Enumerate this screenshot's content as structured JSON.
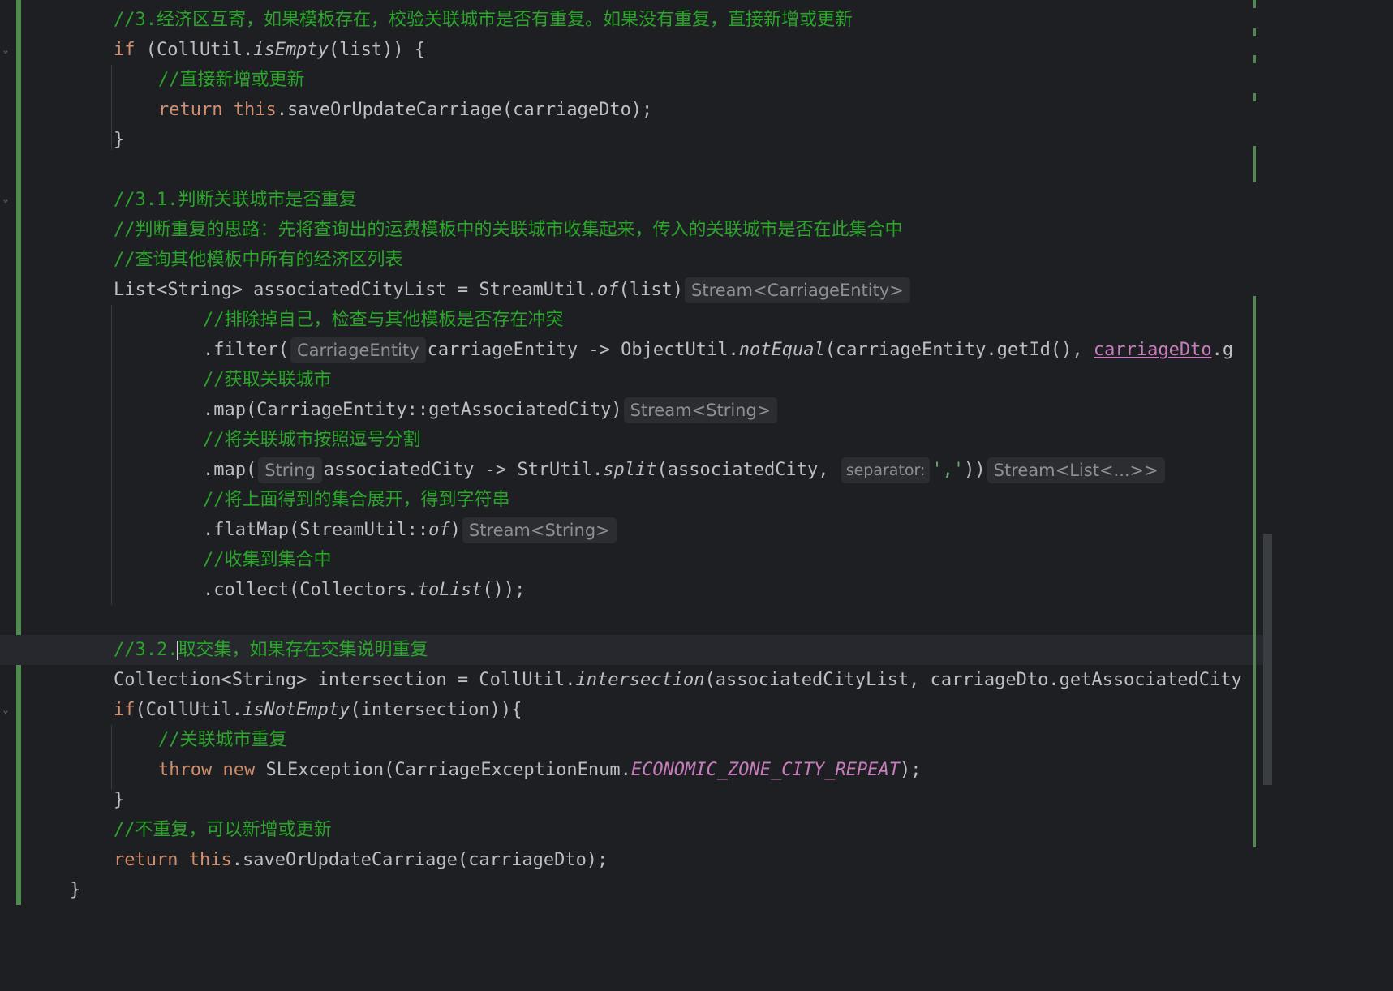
{
  "editor": {
    "lines": [
      {
        "tokens": [
          {
            "t": "//3.经济区互寄，如果模板存在，校验关联城市是否有重复。如果没有重复，直接新增或更新",
            "c": "cm"
          }
        ]
      },
      {
        "tokens": [
          {
            "t": "if",
            "c": "kw"
          },
          {
            "t": " (CollUtil."
          },
          {
            "t": "isEmpty",
            "c": "it"
          },
          {
            "t": "(list)) {"
          }
        ]
      },
      {
        "tokens": [
          {
            "t": "//直接新增或更新",
            "c": "cm"
          }
        ]
      },
      {
        "tokens": [
          {
            "t": "return",
            "c": "kw"
          },
          {
            "t": " "
          },
          {
            "t": "this",
            "c": "kw"
          },
          {
            "t": ".saveOrUpdateCarriage(carriageDto);"
          }
        ]
      },
      {
        "tokens": [
          {
            "t": "}"
          }
        ]
      },
      {
        "tokens": []
      },
      {
        "tokens": [
          {
            "t": "//3.1.判断关联城市是否重复",
            "c": "cm"
          }
        ]
      },
      {
        "tokens": [
          {
            "t": "//判断重复的思路：先将查询出的运费模板中的关联城市收集起来，传入的关联城市是否在此集合中",
            "c": "cm"
          }
        ]
      },
      {
        "tokens": [
          {
            "t": "//查询其他模板中所有的经济区列表",
            "c": "cm"
          }
        ]
      },
      {
        "tokens": [
          {
            "t": "List<String> associatedCityList = StreamUtil."
          },
          {
            "t": "of",
            "c": "it"
          },
          {
            "t": "(list)"
          },
          {
            "t": "Stream<CarriageEntity>",
            "c": "hint"
          }
        ]
      },
      {
        "tokens": [
          {
            "t": "//排除掉自己，检查与其他模板是否存在冲突",
            "c": "cm"
          }
        ]
      },
      {
        "tokens": [
          {
            "t": ".filter("
          },
          {
            "t": "CarriageEntity",
            "c": "hint"
          },
          {
            "t": "carriageEntity -> ObjectUtil."
          },
          {
            "t": "notEqual",
            "c": "it"
          },
          {
            "t": "(carriageEntity.getId(), "
          },
          {
            "t": "carriageDto",
            "c": "err"
          },
          {
            "t": ".g"
          }
        ]
      },
      {
        "tokens": [
          {
            "t": "//获取关联城市",
            "c": "cm"
          }
        ]
      },
      {
        "tokens": [
          {
            "t": ".map(CarriageEntity::getAssociatedCity)"
          },
          {
            "t": "Stream<String>",
            "c": "hint"
          }
        ]
      },
      {
        "tokens": [
          {
            "t": "//将关联城市按照逗号分割",
            "c": "cm"
          }
        ]
      },
      {
        "tokens": [
          {
            "t": ".map("
          },
          {
            "t": "String",
            "c": "hint"
          },
          {
            "t": "associatedCity -> StrUtil."
          },
          {
            "t": "split",
            "c": "it"
          },
          {
            "t": "(associatedCity, "
          },
          {
            "t": "separator:",
            "c": "hint param"
          },
          {
            "t": "','",
            "c": "st"
          },
          {
            "t": "))"
          },
          {
            "t": "Stream<List<...>>",
            "c": "hint"
          }
        ]
      },
      {
        "tokens": [
          {
            "t": "//将上面得到的集合展开，得到字符串",
            "c": "cm"
          }
        ]
      },
      {
        "tokens": [
          {
            "t": ".flatMap(StreamUtil::"
          },
          {
            "t": "of",
            "c": "it"
          },
          {
            "t": ")"
          },
          {
            "t": "Stream<String>",
            "c": "hint"
          }
        ]
      },
      {
        "tokens": [
          {
            "t": "//收集到集合中",
            "c": "cm"
          }
        ]
      },
      {
        "tokens": [
          {
            "t": ".collect(Collectors."
          },
          {
            "t": "toList",
            "c": "it"
          },
          {
            "t": "());"
          }
        ]
      },
      {
        "tokens": []
      },
      {
        "tokens": [
          {
            "t": "//3.2.",
            "c": "cm"
          },
          {
            "t": "",
            "c": "caret"
          },
          {
            "t": "取交集，如果存在交集说明重复",
            "c": "cm"
          }
        ]
      },
      {
        "tokens": [
          {
            "t": "Collection<String> intersection = CollUtil."
          },
          {
            "t": "intersection",
            "c": "it"
          },
          {
            "t": "(associatedCityList, carriageDto.getAssociatedCity"
          }
        ]
      },
      {
        "tokens": [
          {
            "t": "if",
            "c": "kw"
          },
          {
            "t": "(CollUtil."
          },
          {
            "t": "isNotEmpty",
            "c": "it"
          },
          {
            "t": "(intersection)){"
          }
        ]
      },
      {
        "tokens": [
          {
            "t": "//关联城市重复",
            "c": "cm"
          }
        ]
      },
      {
        "tokens": [
          {
            "t": "throw",
            "c": "kw"
          },
          {
            "t": " "
          },
          {
            "t": "new",
            "c": "kw"
          },
          {
            "t": " SLException(CarriageExceptionEnum."
          },
          {
            "t": "ECONOMIC_ZONE_CITY_REPEAT",
            "c": "enumc"
          },
          {
            "t": ");"
          }
        ]
      },
      {
        "tokens": [
          {
            "t": "}"
          }
        ]
      },
      {
        "tokens": [
          {
            "t": "//不重复，可以新增或更新",
            "c": "cm"
          }
        ]
      },
      {
        "tokens": [
          {
            "t": "return",
            "c": "kw"
          },
          {
            "t": " "
          },
          {
            "t": "this",
            "c": "kw"
          },
          {
            "t": ".saveOrUpdateCarriage(carriageDto);"
          }
        ]
      },
      {
        "tokens": [
          {
            "t": "}"
          }
        ]
      }
    ]
  },
  "colors": {
    "background": "#1e1f22",
    "keyword": "#cf8e6d",
    "comment": "#2aa52a",
    "default_text": "#bcbec4",
    "enum_constant": "#c77dbb",
    "vcs_changed_bar": "#4f8a4f"
  },
  "gutter": {
    "fold_icon": "chevron-down-icon"
  }
}
